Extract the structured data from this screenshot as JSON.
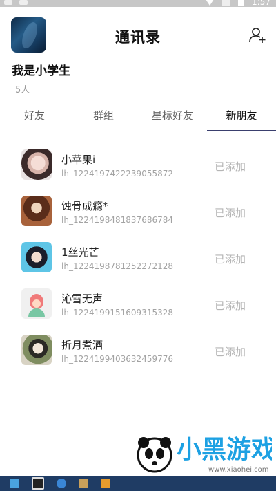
{
  "header": {
    "title": "通讯录",
    "group_name": "我是小学生",
    "member_count": "5人"
  },
  "tabs": [
    {
      "label": "好友",
      "active": false
    },
    {
      "label": "群组",
      "active": false
    },
    {
      "label": "星标好友",
      "active": false
    },
    {
      "label": "新朋友",
      "active": true
    }
  ],
  "friends": [
    {
      "name": "小苹果i",
      "uid": "lh_1224197422239055872",
      "status": "已添加"
    },
    {
      "name": "蚀骨成瘾*",
      "uid": "lh_1224198481837686784",
      "status": "已添加"
    },
    {
      "name": "1丝光芒",
      "uid": "lh_1224198781252272128",
      "status": "已添加"
    },
    {
      "name": "沁雪无声",
      "uid": "lh_1224199151609315328",
      "status": "已添加"
    },
    {
      "name": "折月煮酒",
      "uid": "lh_1224199403632459776",
      "status": "已添加"
    }
  ],
  "status_bar": {
    "time": "1:57"
  },
  "watermark": {
    "text": "小黑游戏",
    "url": "www.xiaohei.com"
  },
  "colors": {
    "accent": "#3a3f6e",
    "muted": "#b5b5b5"
  }
}
